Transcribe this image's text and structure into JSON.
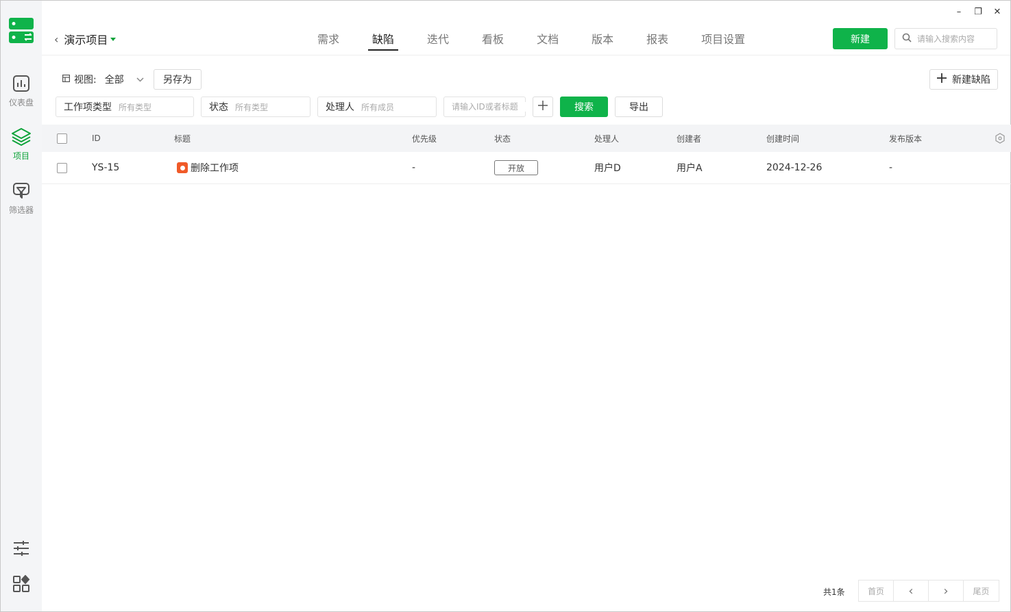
{
  "window": {
    "minimize": "–",
    "restore": "❐",
    "close": "✕"
  },
  "rail": {
    "items": [
      {
        "label": "仪表盘",
        "icon": "dashboard-icon"
      },
      {
        "label": "项目",
        "icon": "layers-icon",
        "active": true
      },
      {
        "label": "筛选器",
        "icon": "filter-icon"
      }
    ],
    "bottom": [
      {
        "icon": "sliders-icon"
      },
      {
        "icon": "apps-icon"
      }
    ]
  },
  "header": {
    "project_name": "演示项目",
    "tabs": [
      {
        "label": "需求"
      },
      {
        "label": "缺陷",
        "active": true
      },
      {
        "label": "迭代"
      },
      {
        "label": "看板"
      },
      {
        "label": "文档"
      },
      {
        "label": "版本"
      },
      {
        "label": "报表"
      },
      {
        "label": "项目设置"
      }
    ],
    "new_button": "新建",
    "search_placeholder": "请输入搜索内容"
  },
  "toolbar": {
    "view_label": "视图:",
    "view_value": "全部",
    "save_as": "另存为",
    "new_defect": "新建缺陷"
  },
  "filters": {
    "type_label": "工作项类型",
    "type_value": "所有类型",
    "status_label": "状态",
    "status_value": "所有类型",
    "assignee_label": "处理人",
    "assignee_value": "所有成员",
    "keyword_placeholder": "请输入ID或者标题",
    "search_button": "搜索",
    "export_button": "导出"
  },
  "table": {
    "columns": [
      "ID",
      "标题",
      "优先级",
      "状态",
      "处理人",
      "创建者",
      "创建时间",
      "发布版本"
    ],
    "rows": [
      {
        "id": "YS-15",
        "title": "删除工作项",
        "priority": "-",
        "status": "开放",
        "assignee": "用户D",
        "creator": "用户A",
        "created": "2024-12-26",
        "release": "-"
      }
    ]
  },
  "pagination": {
    "total": "共1条",
    "first": "首页",
    "prev": "‹",
    "next": "›",
    "last": "尾页"
  },
  "colors": {
    "accent": "#0fb34a",
    "bug": "#f05a28"
  }
}
